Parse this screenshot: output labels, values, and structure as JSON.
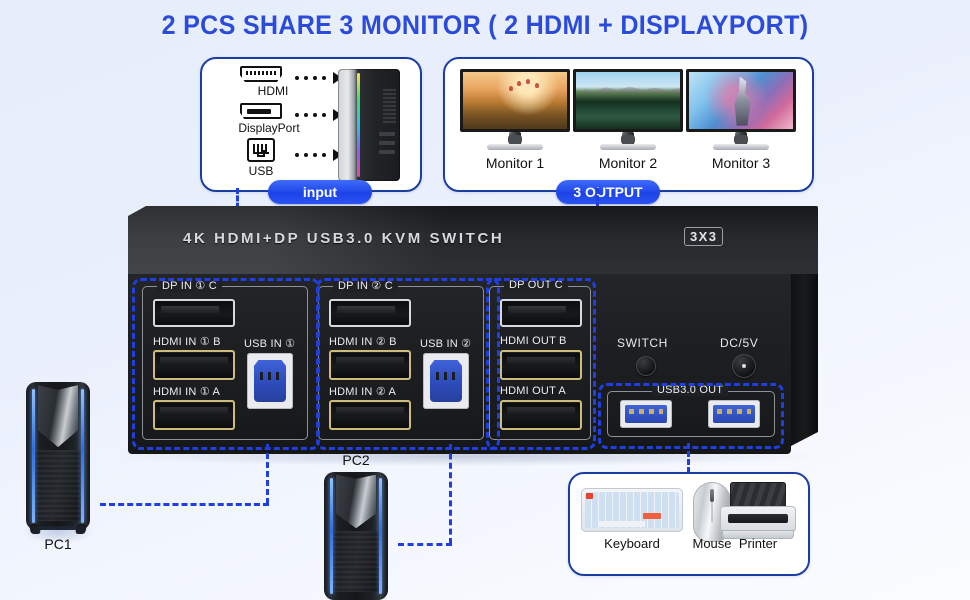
{
  "title": "2 PCS SHARE 3 MONITOR ( 2 HDMI + DISPLAYPORT)",
  "colors": {
    "title_blue": "#2b4bdb",
    "dash_blue": "#1f3fe0",
    "panel_border": "#1b3fa0",
    "badge_blue": "#1d43e8",
    "device_black": "#1d1f22",
    "hdmi_gold": "#cdbc7a",
    "usb_blue": "#2f4fc0"
  },
  "input_panel": {
    "badge": "input",
    "ports": [
      {
        "label": "HDMI",
        "icon": "hdmi-port-icon"
      },
      {
        "label": "DisplayPort",
        "icon": "displayport-port-icon"
      },
      {
        "label": "USB",
        "icon": "usb-port-icon"
      }
    ],
    "computer_alt": "desktop-tower"
  },
  "output_panel": {
    "badge": "3 OUTPUT",
    "monitors": [
      {
        "label": "Monitor 1"
      },
      {
        "label": "Monitor 2"
      },
      {
        "label": "Monitor 3"
      }
    ]
  },
  "device": {
    "brand_text": "4K HDMI+DP USB3.0 KVM SWITCH",
    "model_badge": "3X3",
    "group_in1": {
      "dp_label": "DP IN ① C",
      "hdmi_b_label": "HDMI IN ① B",
      "hdmi_a_label": "HDMI IN ① A",
      "usb_label": "USB IN ①"
    },
    "group_in2": {
      "dp_label": "DP IN ② C",
      "hdmi_b_label": "HDMI IN ② B",
      "hdmi_a_label": "HDMI IN ② A",
      "usb_label": "USB IN ②"
    },
    "group_out": {
      "dp_label": "DP OUT C",
      "hdmi_b_label": "HDMI OUT B",
      "hdmi_a_label": "HDMI OUT A"
    },
    "switch_label": "SWITCH",
    "power_label": "DC/5V",
    "usb_out_label": "USB3.0 OUT"
  },
  "computers": [
    {
      "name": "PC1"
    },
    {
      "name": "PC2"
    }
  ],
  "peripherals_panel": {
    "items": [
      {
        "label": "Keyboard",
        "icon": "keyboard-icon"
      },
      {
        "label": "Mouse",
        "icon": "mouse-icon"
      },
      {
        "label": "Printer",
        "icon": "printer-icon"
      }
    ]
  }
}
